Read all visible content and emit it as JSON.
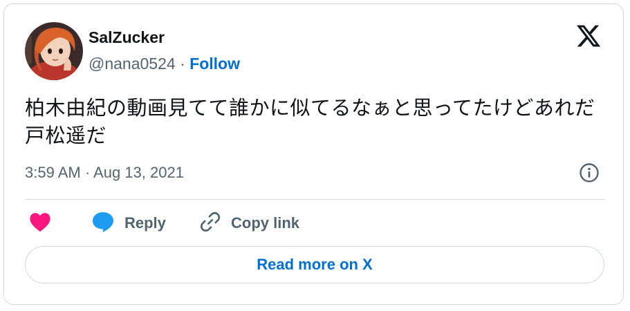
{
  "tweet": {
    "author": {
      "display_name": "SalZucker",
      "handle": "@nana0524",
      "separator": " · ",
      "follow_label": "Follow",
      "avatar_icon": "anime-character-avatar"
    },
    "brand_icon": "x-logo-icon",
    "text": "柏木由紀の動画見てて誰かに似てるなぁと思ってたけどあれだ　戸松遥だ",
    "timestamp": "3:59 AM · Aug 13, 2021",
    "actions": {
      "like_icon": "heart-icon",
      "reply_label": "Reply",
      "reply_icon": "speech-bubble-icon",
      "copy_label": "Copy link",
      "copy_icon": "link-icon"
    },
    "read_more_label": "Read more on X"
  },
  "colors": {
    "accent": "#006fd6",
    "like": "#f91880",
    "reply": "#1d9bf0",
    "muted": "#536471",
    "border": "#cfd9de"
  }
}
